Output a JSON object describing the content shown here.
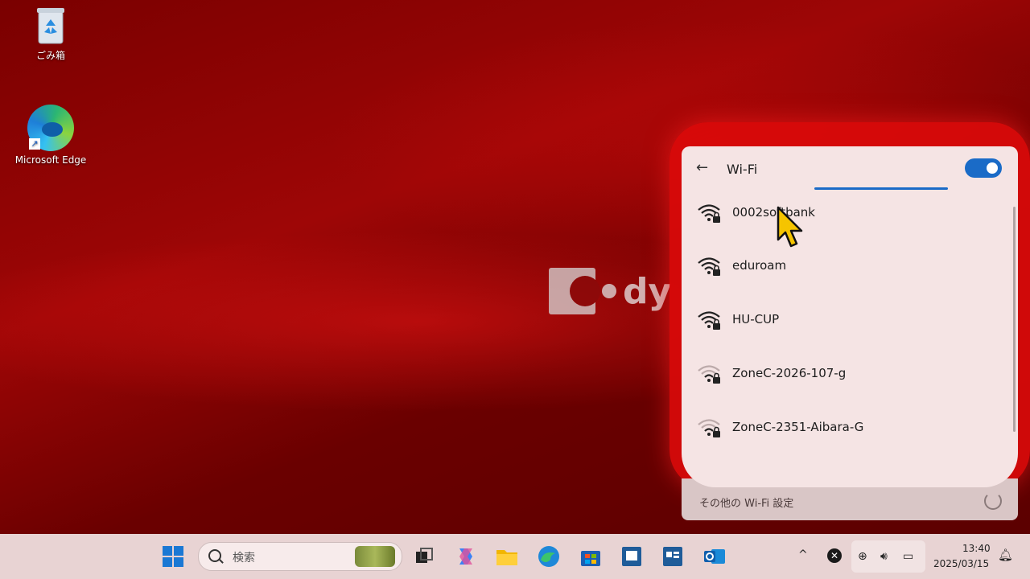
{
  "desktop": {
    "icons": [
      {
        "label": "ごみ箱"
      },
      {
        "label": "Microsoft Edge"
      }
    ]
  },
  "watermark": {
    "text": "dy"
  },
  "wifi_panel": {
    "title": "Wi-Fi",
    "toggle_on": true,
    "networks": [
      {
        "name": "0002softbank",
        "signal": "strong",
        "secured": true
      },
      {
        "name": "eduroam",
        "signal": "strong",
        "secured": true
      },
      {
        "name": "HU-CUP",
        "signal": "strong",
        "secured": true
      },
      {
        "name": "ZoneC-2026-107-g",
        "signal": "weak",
        "secured": true
      },
      {
        "name": "ZoneC-2351-Aibara-G",
        "signal": "weak",
        "secured": true
      }
    ],
    "more_settings": "その他の Wi-Fi 設定"
  },
  "taskbar": {
    "search_placeholder": "検索",
    "clock_time": "13:40",
    "clock_date": "2025/03/15",
    "apps": [
      "start",
      "search",
      "task-view",
      "copilot",
      "file-explorer",
      "edge",
      "store",
      "app-1",
      "app-2",
      "outlook"
    ]
  },
  "colors": {
    "accent": "#1a6bc7",
    "panel_bg": "#f5e4e4",
    "taskbar_bg": "#e8d3d3"
  }
}
